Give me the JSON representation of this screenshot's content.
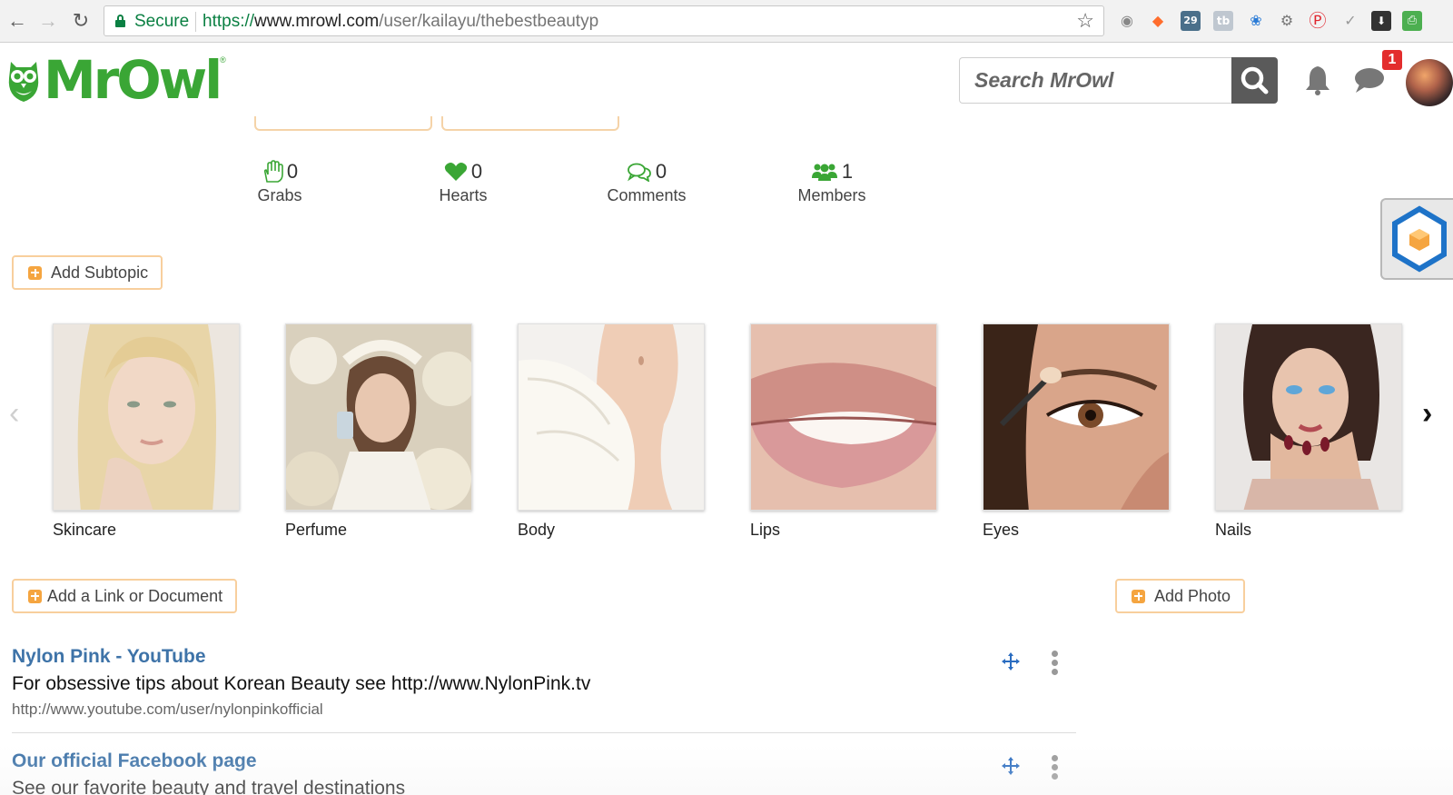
{
  "browser": {
    "secure_label": "Secure",
    "url_protocol": "https://",
    "url_host": "www.mrowl.com",
    "url_path": "/user/kailayu/thebestbeautyp",
    "extension_badge": "29"
  },
  "header": {
    "logo_text": "MrOwl",
    "logo_reg": "®",
    "search_placeholder": "Search MrOwl",
    "notification_count": "1"
  },
  "stats": [
    {
      "icon": "grab-hand-icon",
      "value": "0",
      "label": "Grabs"
    },
    {
      "icon": "heart-icon",
      "value": "0",
      "label": "Hearts"
    },
    {
      "icon": "comments-icon",
      "value": "0",
      "label": "Comments"
    },
    {
      "icon": "members-icon",
      "value": "1",
      "label": "Members"
    }
  ],
  "actions": {
    "add_subtopic": "Add Subtopic",
    "add_link": "Add a Link or Document",
    "add_photo": "Add Photo"
  },
  "subtopics": [
    {
      "label": "Skincare"
    },
    {
      "label": "Perfume"
    },
    {
      "label": "Body"
    },
    {
      "label": "Lips"
    },
    {
      "label": "Eyes"
    },
    {
      "label": "Nails"
    }
  ],
  "links": [
    {
      "title": "Nylon Pink - YouTube",
      "description": "For obsessive tips about Korean Beauty see http://www.NylonPink.tv",
      "url": "http://www.youtube.com/user/nylonpinkofficial"
    },
    {
      "title": "Our official Facebook page",
      "description": "See our favorite beauty and travel destinations"
    }
  ],
  "colors": {
    "brand_green": "#3aa635",
    "accent_orange": "#f5a540",
    "link_blue": "#3e73a8",
    "badge_red": "#e32d2d"
  }
}
